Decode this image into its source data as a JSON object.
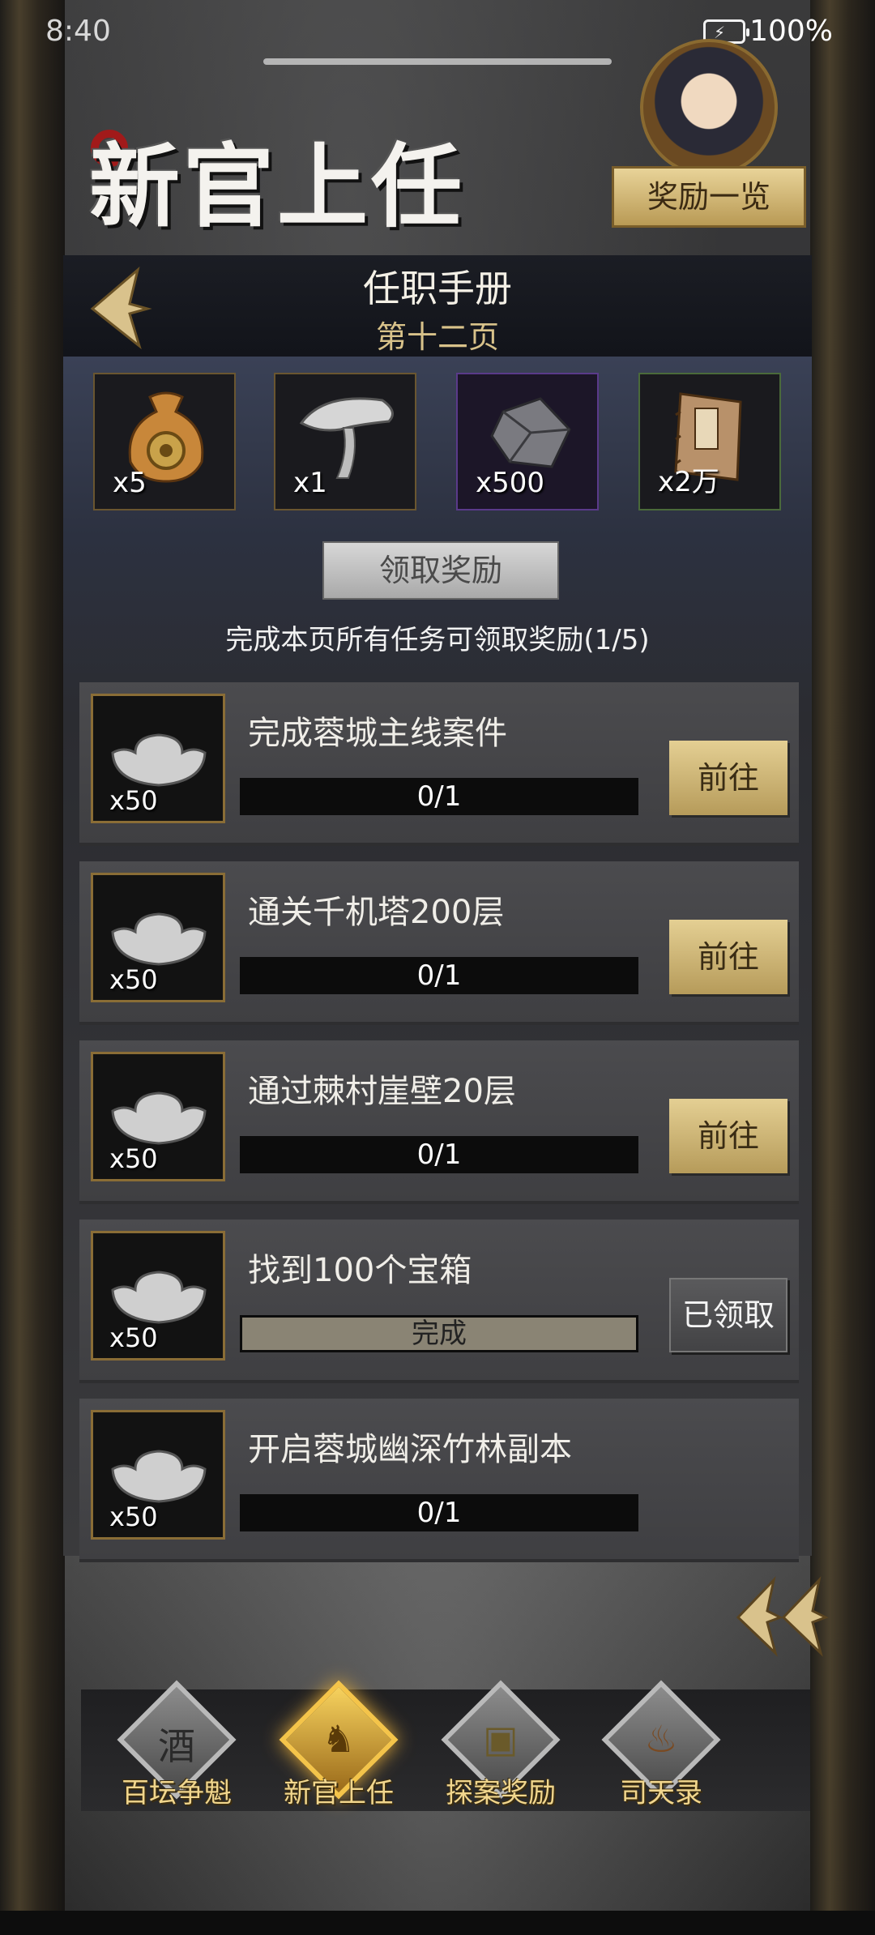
{
  "status_bar": {
    "time": "8:40",
    "battery": "100%"
  },
  "header": {
    "brand_title": "新官上任",
    "reward_list_button": "奖励一览"
  },
  "page": {
    "title": "任职手册",
    "subtitle": "第十二页"
  },
  "page_rewards": [
    {
      "icon": "pouch-icon",
      "qty": "x5"
    },
    {
      "icon": "lingzhi-mushroom-icon",
      "qty": "x1"
    },
    {
      "icon": "ore-stone-icon",
      "qty": "x500"
    },
    {
      "icon": "martial-book-icon",
      "qty": "x2万"
    }
  ],
  "claim": {
    "button": "领取奖励",
    "hint": "完成本页所有任务可领取奖励(1/5)"
  },
  "tasks": [
    {
      "name": "完成蓉城主线案件",
      "reward_qty": "x50",
      "progress": "0/1",
      "action": "前往",
      "status": "go"
    },
    {
      "name": "通关千机塔200层",
      "reward_qty": "x50",
      "progress": "0/1",
      "action": "前往",
      "status": "go"
    },
    {
      "name": "通过棘村崖壁20层",
      "reward_qty": "x50",
      "progress": "0/1",
      "action": "前往",
      "status": "go"
    },
    {
      "name": "找到100个宝箱",
      "reward_qty": "x50",
      "progress": "完成",
      "action": "已领取",
      "status": "claimed"
    },
    {
      "name": "开启蓉城幽深竹林副本",
      "reward_qty": "x50",
      "progress": "0/1",
      "action": "",
      "status": "none"
    }
  ],
  "bottom_nav": [
    {
      "label": "百坛争魁",
      "icon": "wine-jar-icon",
      "active": false
    },
    {
      "label": "新官上任",
      "icon": "golden-lion-icon",
      "active": true
    },
    {
      "label": "探案奖励",
      "icon": "treasure-box-icon",
      "active": false
    },
    {
      "label": "司天录",
      "icon": "bronze-vessel-icon",
      "active": false
    }
  ],
  "colors": {
    "gold_button": "#e4cf93",
    "nav_label": "#f1d68d",
    "subtitle": "#d8c28a"
  }
}
